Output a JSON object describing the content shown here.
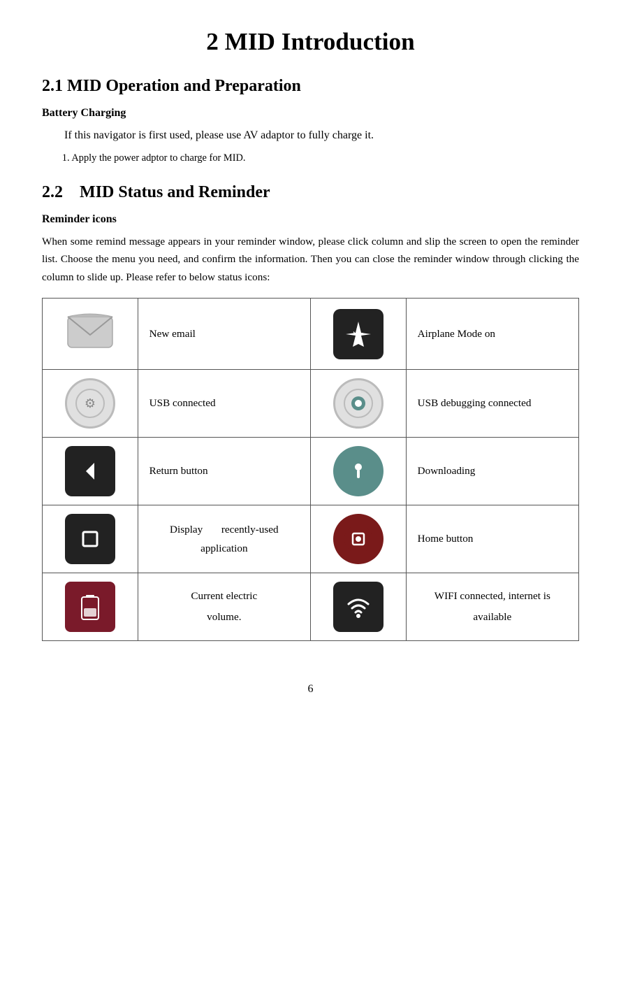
{
  "page": {
    "title": "2 MID Introduction",
    "page_number": "6"
  },
  "section_2_1": {
    "heading": "2.1 MID Operation and Preparation",
    "subsection": "Battery Charging",
    "para1": "If this navigator is first used, please use AV adaptor to fully charge it.",
    "para2": "1. Apply the power adptor to charge for MID."
  },
  "section_2_2": {
    "heading": "2.2 MID Status and Reminder",
    "subsection": "Reminder icons",
    "reminder_text": "When some remind message appears in your reminder window, please click column and slip the screen to open the reminder list. Choose the menu you need, and confirm the information. Then you can close the reminder window through clicking the column to slide up. Please refer to below status icons:"
  },
  "table": {
    "rows": [
      {
        "left_icon": "email-icon",
        "left_label": "New email",
        "right_icon": "airplane-icon",
        "right_label": "Airplane Mode on"
      },
      {
        "left_icon": "usb-connected-icon",
        "left_label": "USB connected",
        "right_icon": "usb-debug-icon",
        "right_label": "USB debugging connected"
      },
      {
        "left_icon": "return-button-icon",
        "left_label": "Return button",
        "right_icon": "downloading-icon",
        "right_label": "Downloading"
      },
      {
        "left_icon": "recent-apps-icon",
        "left_label": "Display      recently-used application",
        "right_icon": "home-button-icon",
        "right_label": "Home button"
      },
      {
        "left_icon": "battery-icon",
        "left_label": "Current electric volume.",
        "right_icon": "wifi-icon",
        "right_label": "WIFI connected, internet is available"
      }
    ]
  }
}
